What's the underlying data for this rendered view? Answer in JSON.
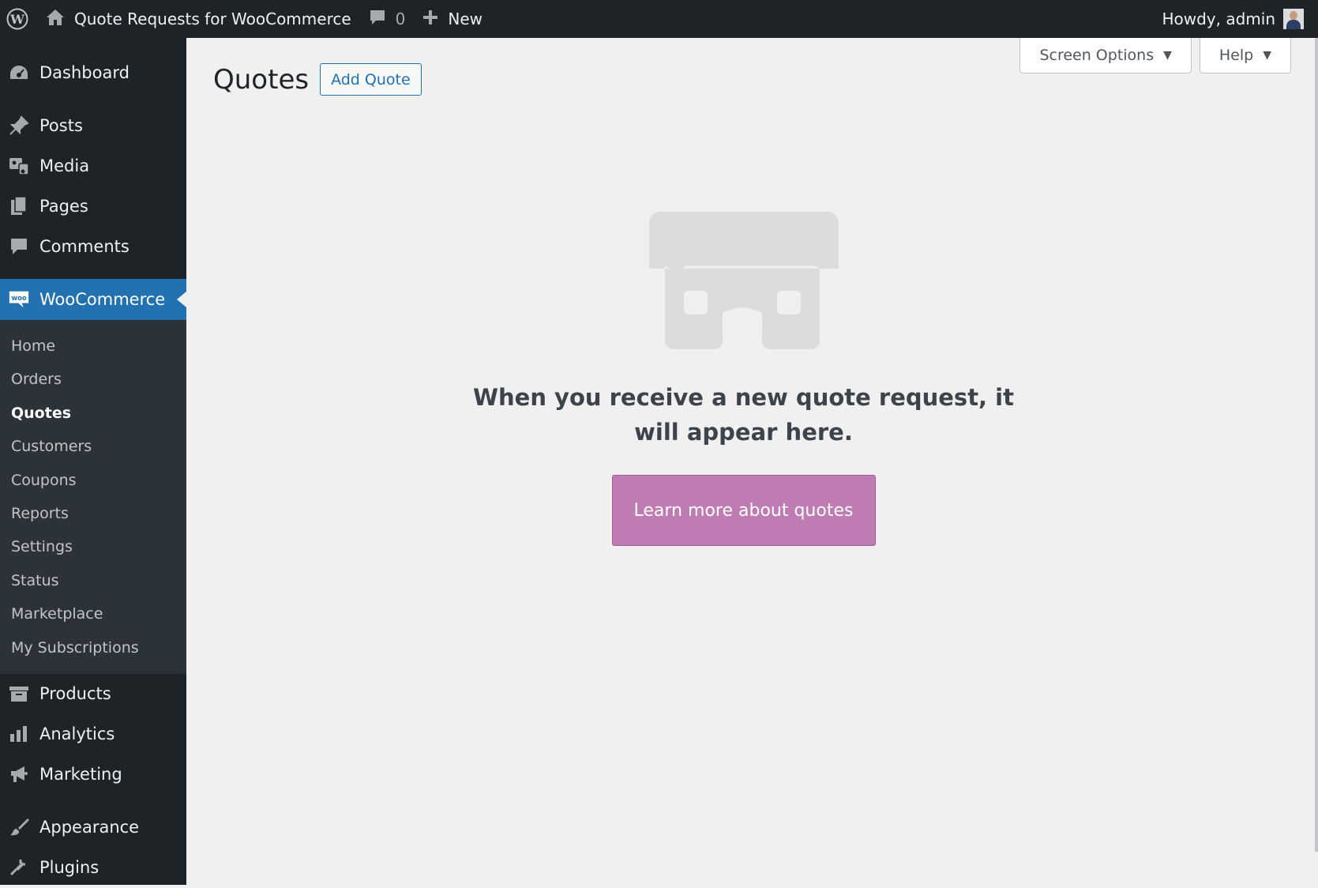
{
  "adminbar": {
    "site_name": "Quote Requests for WooCommerce",
    "comments_count": "0",
    "new_label": "New",
    "howdy": "Howdy, admin",
    "icons": [
      "wordpress-logo-icon",
      "home-icon",
      "comment-icon",
      "plus-icon",
      "avatar"
    ]
  },
  "sidebar": {
    "top_items": [
      {
        "label": "Dashboard",
        "icon": "dashboard-icon"
      },
      {
        "label": "Posts",
        "icon": "pin-icon"
      },
      {
        "label": "Media",
        "icon": "media-icon"
      },
      {
        "label": "Pages",
        "icon": "pages-icon"
      },
      {
        "label": "Comments",
        "icon": "comment-icon"
      }
    ],
    "woocommerce": {
      "label": "WooCommerce",
      "icon": "woo-icon"
    },
    "submenu": [
      "Home",
      "Orders",
      "Quotes",
      "Customers",
      "Coupons",
      "Reports",
      "Settings",
      "Status",
      "Marketplace",
      "My Subscriptions"
    ],
    "current_sub": "Quotes",
    "bottom_items": [
      {
        "label": "Products",
        "icon": "archive-icon"
      },
      {
        "label": "Analytics",
        "icon": "bar-chart-icon"
      },
      {
        "label": "Marketing",
        "icon": "megaphone-icon"
      },
      {
        "label": "Appearance",
        "icon": "brush-icon"
      },
      {
        "label": "Plugins",
        "icon": "plug-icon"
      }
    ]
  },
  "main": {
    "title": "Quotes",
    "add_button": "Add Quote",
    "screen_options": "Screen Options",
    "help": "Help",
    "empty_message": "When you receive a new quote request, it will appear here.",
    "learn_button": "Learn more about quotes"
  },
  "colors": {
    "adminbar_bg": "#1d2327",
    "current_menu": "#2271b1",
    "learn_button": "#bf7cb2",
    "page_bg": "#f0f0f1"
  }
}
